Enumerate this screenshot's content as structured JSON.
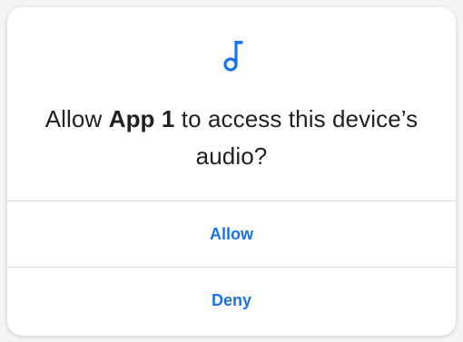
{
  "dialog": {
    "icon": "music-note-icon",
    "title_prefix": "Allow ",
    "app_name": "App 1",
    "title_suffix": " to access this device’s audio?",
    "allow_label": "Allow",
    "deny_label": "Deny"
  },
  "colors": {
    "accent": "#1a73e8",
    "text": "#202124",
    "divider": "#dadce0"
  }
}
